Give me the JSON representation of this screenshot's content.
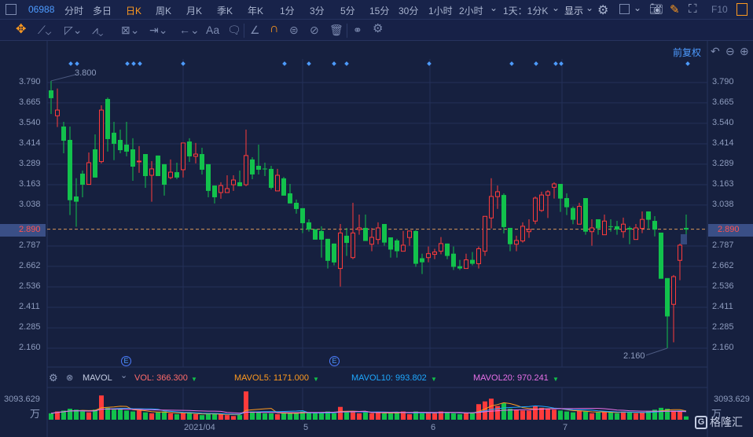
{
  "topbar": {
    "code": "06988",
    "tabs": [
      "分时",
      "多日",
      "日K",
      "周K",
      "月K",
      "季K",
      "年K",
      "1分",
      "3分",
      "5分",
      "15分",
      "30分",
      "1小时",
      "2小时"
    ],
    "active_tab": "日K",
    "period_select": "1天：1分K",
    "display": "显示",
    "f10": "F10",
    "more": "⌄"
  },
  "toolbar": {
    "text_tool": "Aa"
  },
  "chart_header": {
    "adjust": "前复权"
  },
  "colors": {
    "up": "#ff3b3b",
    "down": "#12c24c",
    "bg": "#16203f",
    "grid": "#243158",
    "price_line": "#d9965a",
    "vol": "#ff6b6b",
    "mavol5": "#ff9a1f",
    "mavol10": "#1ea8ff",
    "mavol20": "#e870e8"
  },
  "chart_data": {
    "type": "candlestick",
    "y_ticks": [
      "3.790",
      "3.665",
      "3.540",
      "3.414",
      "3.289",
      "3.163",
      "3.038",
      "2.787",
      "2.662",
      "2.536",
      "2.411",
      "2.285",
      "2.160"
    ],
    "ylim": [
      2.16,
      3.79
    ],
    "current_price": "2.890",
    "high_label": "3.800",
    "low_label": "2.160",
    "x_labels": [
      "2021/04",
      "5",
      "6",
      "7"
    ],
    "ohlc": [
      [
        3.742,
        3.8,
        3.597,
        3.694
      ],
      [
        3.586,
        3.753,
        3.517,
        3.621
      ],
      [
        3.52,
        3.549,
        3.356,
        3.433
      ],
      [
        3.438,
        3.52,
        2.977,
        3.068
      ],
      [
        3.091,
        3.203,
        2.905,
        3.059
      ],
      [
        3.231,
        3.25,
        3.086,
        3.163
      ],
      [
        3.165,
        3.361,
        3.165,
        3.298
      ],
      [
        3.38,
        3.472,
        3.207,
        3.207
      ],
      [
        3.305,
        3.65,
        3.294,
        3.621
      ],
      [
        3.689,
        3.698,
        3.366,
        3.443
      ],
      [
        3.482,
        3.549,
        3.314,
        3.414
      ],
      [
        3.438,
        3.501,
        3.356,
        3.375
      ],
      [
        3.409,
        3.549,
        3.337,
        3.366
      ],
      [
        3.38,
        3.448,
        3.187,
        3.274
      ],
      [
        3.306,
        3.4,
        3.236,
        3.308
      ],
      [
        3.351,
        3.351,
        3.144,
        3.216
      ],
      [
        3.221,
        3.308,
        3.059,
        3.26
      ],
      [
        3.342,
        3.342,
        3.216,
        3.216
      ],
      [
        3.289,
        3.289,
        3.096,
        3.163
      ],
      [
        3.207,
        3.318,
        3.197,
        3.24
      ],
      [
        3.24,
        3.298,
        3.197,
        3.207
      ],
      [
        3.255,
        3.419,
        3.207,
        3.419
      ],
      [
        3.428,
        3.448,
        3.303,
        3.337
      ],
      [
        3.337,
        3.419,
        3.294,
        3.351
      ],
      [
        3.351,
        3.39,
        3.226,
        3.255
      ],
      [
        3.289,
        3.289,
        3.086,
        3.125
      ],
      [
        3.158,
        3.158,
        3.048,
        3.086
      ],
      [
        3.115,
        3.178,
        3.077,
        3.158
      ],
      [
        3.115,
        3.221,
        3.115,
        3.139
      ],
      [
        3.163,
        3.221,
        3.125,
        3.192
      ],
      [
        3.178,
        3.25,
        3.154,
        3.154
      ],
      [
        3.163,
        3.501,
        3.154,
        3.342
      ],
      [
        3.318,
        3.332,
        3.197,
        3.226
      ],
      [
        3.279,
        3.409,
        3.226,
        3.255
      ],
      [
        3.262,
        3.298,
        3.216,
        3.26
      ],
      [
        3.26,
        3.279,
        3.134,
        3.144
      ],
      [
        3.125,
        3.26,
        3.125,
        3.221
      ],
      [
        3.202,
        3.211,
        3.096,
        3.096
      ],
      [
        3.11,
        3.168,
        3.048,
        3.048
      ],
      [
        3.052,
        3.072,
        2.985,
        3.014
      ],
      [
        3.019,
        3.019,
        2.866,
        2.927
      ],
      [
        2.932,
        2.951,
        2.875,
        2.888
      ],
      [
        2.89,
        2.89,
        2.826,
        2.826
      ],
      [
        2.879,
        2.908,
        2.716,
        2.826
      ],
      [
        2.831,
        2.831,
        2.649,
        2.696
      ],
      [
        2.802,
        2.802,
        2.668,
        2.686
      ],
      [
        2.649,
        2.922,
        2.538,
        2.867
      ],
      [
        2.85,
        2.898,
        2.726,
        2.806
      ],
      [
        2.716,
        3.052,
        2.706,
        2.867
      ],
      [
        2.888,
        2.98,
        2.856,
        2.898
      ],
      [
        2.898,
        2.98,
        2.818,
        2.818
      ],
      [
        2.798,
        2.898,
        2.755,
        2.84
      ],
      [
        2.827,
        2.932,
        2.798,
        2.898
      ],
      [
        2.922,
        2.922,
        2.789,
        2.808
      ],
      [
        2.84,
        2.84,
        2.716,
        2.765
      ],
      [
        2.821,
        2.831,
        2.716,
        2.755
      ],
      [
        2.755,
        2.879,
        2.755,
        2.792
      ],
      [
        2.839,
        2.879,
        2.789,
        2.879
      ],
      [
        2.879,
        2.884,
        2.659,
        2.678
      ],
      [
        2.712,
        2.74,
        2.615,
        2.687
      ],
      [
        2.716,
        2.784,
        2.687,
        2.74
      ],
      [
        2.736,
        2.77,
        2.706,
        2.75
      ],
      [
        2.755,
        2.842,
        2.736,
        2.802
      ],
      [
        2.802,
        2.802,
        2.706,
        2.726
      ],
      [
        2.74,
        2.784,
        2.64,
        2.659
      ],
      [
        2.663,
        2.702,
        2.64,
        2.649
      ],
      [
        2.649,
        2.74,
        2.649,
        2.702
      ],
      [
        2.702,
        2.75,
        2.668,
        2.678
      ],
      [
        2.678,
        2.784,
        2.649,
        2.77
      ],
      [
        2.755,
        2.969,
        2.726,
        2.969
      ],
      [
        2.959,
        3.203,
        2.895,
        3.091
      ],
      [
        3.09,
        3.158,
        3.015,
        3.12
      ],
      [
        3.1,
        3.11,
        2.864,
        2.903
      ],
      [
        2.898,
        2.898,
        2.755,
        2.798
      ],
      [
        2.798,
        2.85,
        2.755,
        2.821
      ],
      [
        2.818,
        2.932,
        2.808,
        2.908
      ],
      [
        2.875,
        2.951,
        2.837,
        2.888
      ],
      [
        2.94,
        3.091,
        2.921,
        3.081
      ],
      [
        3.005,
        3.12,
        2.996,
        3.1
      ],
      [
        3.099,
        3.13,
        2.959,
        3.12
      ],
      [
        3.147,
        3.178,
        3.078,
        3.168
      ],
      [
        3.168,
        3.168,
        2.996,
        3.078
      ],
      [
        3.081,
        3.11,
        2.977,
        3.025
      ],
      [
        3.02,
        3.03,
        2.921,
        2.948
      ],
      [
        2.921,
        3.052,
        2.921,
        3.03
      ],
      [
        3.081,
        3.081,
        2.856,
        2.875
      ],
      [
        2.875,
        2.951,
        2.789,
        2.898
      ],
      [
        2.951,
        2.951,
        2.856,
        2.895
      ],
      [
        2.856,
        2.98,
        2.856,
        2.94
      ],
      [
        2.908,
        2.951,
        2.875,
        2.906
      ],
      [
        2.908,
        2.941,
        2.856,
        2.888
      ],
      [
        2.875,
        2.961,
        2.837,
        2.921
      ],
      [
        2.898,
        2.908,
        2.798,
        2.888
      ],
      [
        2.827,
        2.922,
        2.827,
        2.898
      ],
      [
        2.895,
        2.999,
        2.866,
        2.95
      ],
      [
        2.999,
        2.999,
        2.895,
        2.948
      ],
      [
        2.941,
        2.97,
        2.846,
        2.888
      ],
      [
        2.869,
        2.869,
        2.586,
        2.586
      ],
      [
        2.59,
        2.59,
        2.16,
        2.355
      ],
      [
        2.429,
        2.609,
        2.196,
        2.599
      ],
      [
        2.699,
        2.802,
        2.577,
        2.792
      ],
      [
        2.898,
        2.98,
        2.856,
        2.888
      ]
    ],
    "volume": {
      "max_label": "3093.629",
      "unit": "万",
      "max": 3093.629,
      "values": [
        700,
        900,
        1000,
        1200,
        1100,
        900,
        800,
        1100,
        2650,
        1300,
        1100,
        1200,
        1000,
        900,
        1000,
        800,
        700,
        800,
        900,
        700,
        600,
        700,
        800,
        600,
        500,
        600,
        700,
        600,
        500,
        400,
        500,
        3093.629,
        900,
        800,
        700,
        700,
        600,
        800,
        700,
        700,
        900,
        800,
        700,
        800,
        900,
        700,
        1400,
        800,
        900,
        700,
        800,
        700,
        800,
        700,
        700,
        800,
        900,
        600,
        900,
        700,
        800,
        700,
        900,
        800,
        700,
        600,
        700,
        800,
        1700,
        2000,
        2300,
        1500,
        1800,
        1200,
        1100,
        1000,
        1000,
        1500,
        1300,
        1200,
        1100,
        1000,
        900,
        800,
        1000,
        900,
        700,
        800,
        900,
        800,
        700,
        900,
        800,
        700,
        800,
        900,
        1100,
        1300,
        1200,
        1000,
        900,
        366.3
      ]
    }
  },
  "volume_header": {
    "name": "MAVOL",
    "vol": "VOL: 366.300",
    "mavol5": "MAVOL5: 1171.000",
    "mavol10": "MAVOL10: 993.802",
    "mavol20": "MAVOL20: 970.241"
  },
  "logo": "格隆汇"
}
